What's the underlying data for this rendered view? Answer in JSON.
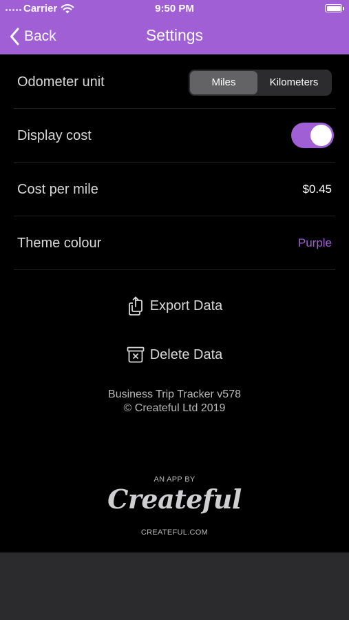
{
  "status_bar": {
    "carrier": "Carrier",
    "time": "9:50 PM"
  },
  "nav": {
    "back_label": "Back",
    "title": "Settings"
  },
  "settings": {
    "odometer": {
      "label": "Odometer unit",
      "options": [
        "Miles",
        "Kilometers"
      ],
      "selected": "Miles"
    },
    "display_cost": {
      "label": "Display cost",
      "enabled": true
    },
    "cost_per_mile": {
      "label": "Cost per mile",
      "value": "$0.45"
    },
    "theme_colour": {
      "label": "Theme colour",
      "value": "Purple"
    }
  },
  "actions": {
    "export_label": "Export Data",
    "delete_label": "Delete Data"
  },
  "footer": {
    "app_version": "Business Trip Tracker v578",
    "copyright": "© Createful Ltd 2019",
    "an_app_by": "AN APP BY",
    "brand": "Createful",
    "brand_url": "CREATEFUL.COM"
  },
  "colors": {
    "accent": "#a15fd6",
    "background": "#000000",
    "bottom_bar": "#2b2b2d"
  },
  "icons": {
    "back": "chevron-left-icon",
    "wifi": "wifi-icon",
    "battery": "battery-icon",
    "export": "share-icon",
    "delete": "delete-box-icon"
  }
}
